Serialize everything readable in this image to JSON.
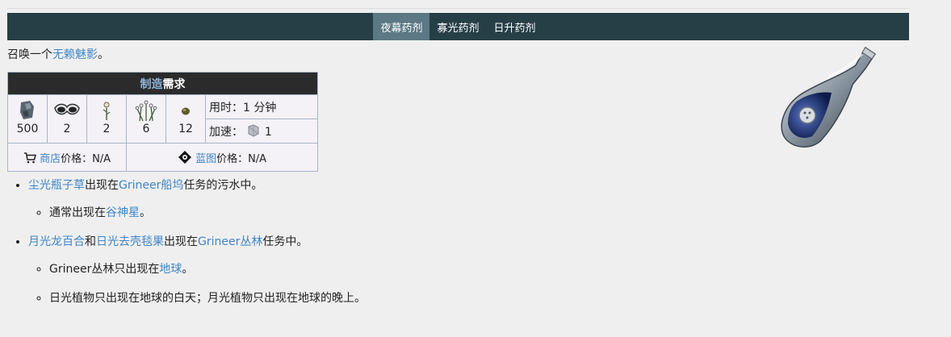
{
  "tabs": [
    {
      "label": "夜幕药剂",
      "active": true
    },
    {
      "label": "寡光药剂",
      "active": false
    },
    {
      "label": "日升药剂",
      "active": false
    }
  ],
  "summary": {
    "prefix": "召唤一个",
    "link": "无赖魅影",
    "suffix": "。"
  },
  "craft": {
    "title_link": "制造",
    "title_rest": "需求",
    "resources": [
      {
        "icon": "ferrite-icon",
        "count": "500"
      },
      {
        "icon": "goggles-icon",
        "count": "2"
      },
      {
        "icon": "sprout-icon",
        "count": "2"
      },
      {
        "icon": "flower-cluster-icon",
        "count": "6"
      },
      {
        "icon": "seed-icon",
        "count": "12"
      }
    ],
    "time_label": "用时：1 分钟",
    "rush_label": "加速：",
    "rush_value": "1",
    "market_link": "商店",
    "market_text": "价格：N/A",
    "blueprint_link": "蓝图",
    "blueprint_text": "价格：N/A"
  },
  "list": {
    "item1": {
      "link1": "尘光瓶子草",
      "text1": "出现在",
      "link2": "Grineer船坞",
      "text2": "任务的污水中。"
    },
    "item1_sub": {
      "text1": "通常出现在",
      "link1": "谷神星",
      "text2": "。"
    },
    "item2": {
      "link1": "月光龙百合",
      "text1": "和",
      "link2": "日光去壳毯果",
      "text2": "出现在",
      "link3": "Grineer丛林",
      "text3": "任务中。"
    },
    "item2_sub1": {
      "text1": "Grineer丛林只出现在",
      "link1": "地球",
      "text2": "。"
    },
    "item2_sub2": {
      "text1": "日光植物只出现在地球的白天；月光植物只出现在地球的晚上。"
    }
  }
}
